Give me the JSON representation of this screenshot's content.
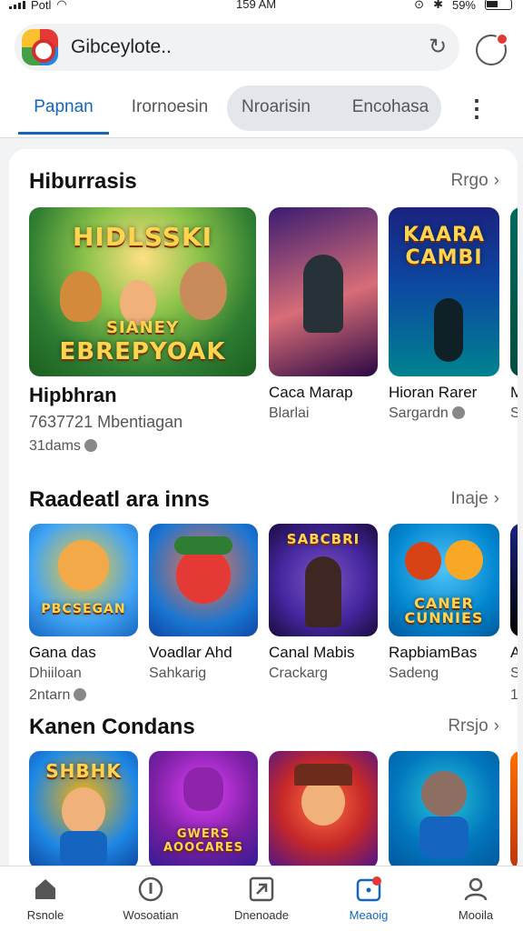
{
  "status": {
    "carrier": "Potl",
    "time": "159 AM",
    "battery": "59%"
  },
  "search": {
    "title": "Gibceylote..",
    "logo_icon": "app-logo-icon",
    "refresh_icon": "refresh-icon",
    "notify_icon": "notification-icon"
  },
  "tabs": [
    {
      "label": "Papnan",
      "active": true
    },
    {
      "label": "Irornoesin",
      "active": false
    },
    {
      "label": "Nroarisin",
      "active": false
    },
    {
      "label": "Encohasa",
      "active": false
    }
  ],
  "sections": [
    {
      "title": "Hiburrasis",
      "more": "Rrgo",
      "featured": {
        "art_title_1": "HIDLSSKI",
        "art_title_2": "SIANEY",
        "art_title_3": "EBREPYOAK",
        "name": "Hipbhran",
        "line2": "7637721 Mbentiagan",
        "line3": "31dams"
      },
      "items": [
        {
          "name": "Caca Marap",
          "sub": "Blarlai",
          "art": ""
        },
        {
          "name": "Hioran Rarer",
          "sub": "Sargardn",
          "art": "KAARA CAMBI"
        },
        {
          "name": "M",
          "sub": "S",
          "art": ""
        }
      ]
    },
    {
      "title": "Raadeatl ara inns",
      "more": "Inaje",
      "items": [
        {
          "name": "Gana das",
          "sub": "Dhiiloan",
          "extra": "2ntarn",
          "art": "PBCSEGAN"
        },
        {
          "name": "Voadlar Ahd",
          "sub": "Sahkarig",
          "extra": "",
          "art": ""
        },
        {
          "name": "Canal Mabis",
          "sub": "Crackarg",
          "extra": "",
          "art": "SABCBRI"
        },
        {
          "name": "RapbiamBas",
          "sub": "Sadeng",
          "extra": "",
          "art": "CANER CUNNIES"
        },
        {
          "name": "A",
          "sub": "S",
          "extra": "1",
          "art": ""
        }
      ]
    },
    {
      "title": "Kanen Condans",
      "more": "Rrsjo",
      "items": [
        {
          "art": "SHBHK"
        },
        {
          "art": "GWERS AOOCARES"
        },
        {
          "art": ""
        },
        {
          "art": ""
        }
      ]
    }
  ],
  "bottom_nav": [
    {
      "label": "Rsnole",
      "icon": "home-icon",
      "active": false
    },
    {
      "label": "Wosoatian",
      "icon": "info-icon",
      "active": false
    },
    {
      "label": "Dnenoade",
      "icon": "download-icon",
      "active": false
    },
    {
      "label": "Meaoig",
      "icon": "inbox-icon",
      "active": true
    },
    {
      "label": "Mooila",
      "icon": "profile-icon",
      "active": false
    }
  ],
  "colors": {
    "accent": "#1565c0",
    "badge": "#e53935"
  }
}
